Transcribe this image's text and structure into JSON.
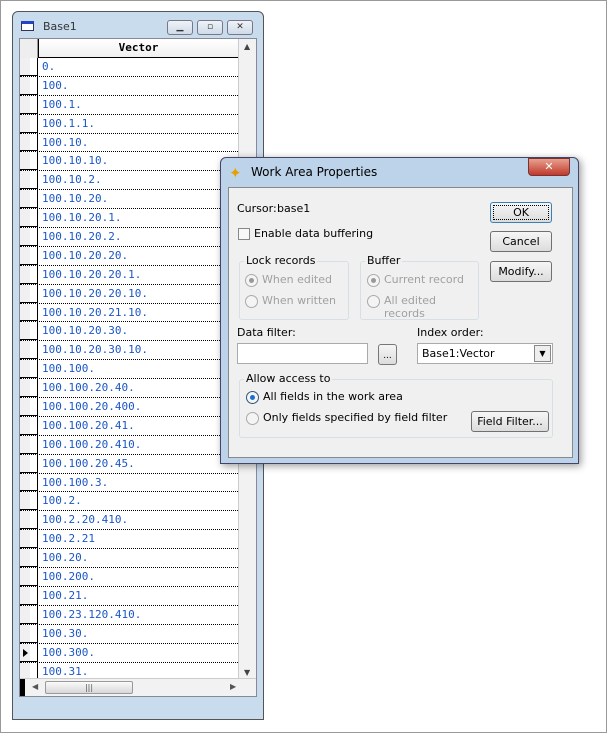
{
  "base_window": {
    "title": "Base1",
    "column_header": "Vector",
    "rows": [
      "0.",
      "100.",
      "100.1.",
      "100.1.1.",
      "100.10.",
      "100.10.10.",
      "100.10.2.",
      "100.10.20.",
      "100.10.20.1.",
      "100.10.20.2.",
      "100.10.20.20.",
      "100.10.20.20.1.",
      "100.10.20.20.10.",
      "100.10.20.21.10.",
      "100.10.20.30.",
      "100.10.20.30.10.",
      "100.100.",
      "100.100.20.40.",
      "100.100.20.400.",
      "100.100.20.41.",
      "100.100.20.410.",
      "100.100.20.45.",
      "100.100.3.",
      "100.2.",
      "100.2.20.410.",
      "100.2.21",
      "100.20.",
      "100.200.",
      "100.21.",
      "100.23.120.410.",
      "100.30.",
      "100.300.",
      "100.31."
    ],
    "current_row": 31
  },
  "dialog": {
    "title": "Work Area Properties",
    "cursor_label": "Cursor:",
    "cursor_value": "base1",
    "enable_buffering": "Enable data buffering",
    "enable_buffering_checked": false,
    "ok": "OK",
    "cancel": "Cancel",
    "modify": "Modify...",
    "lock_records": {
      "label": "Lock records",
      "options": [
        "When edited",
        "When written"
      ],
      "selected": 0
    },
    "buffer": {
      "label": "Buffer",
      "options": [
        "Current record",
        "All edited records"
      ],
      "selected": 0
    },
    "data_filter_label": "Data filter:",
    "data_filter_value": "",
    "ellipsis": "...",
    "index_order_label": "Index order:",
    "index_order_value": "Base1:Vector",
    "allow_access": {
      "label": "Allow access to",
      "options": [
        "All fields in the work area",
        "Only fields specified by field filter"
      ],
      "selected": 0
    },
    "field_filter": "Field Filter..."
  }
}
